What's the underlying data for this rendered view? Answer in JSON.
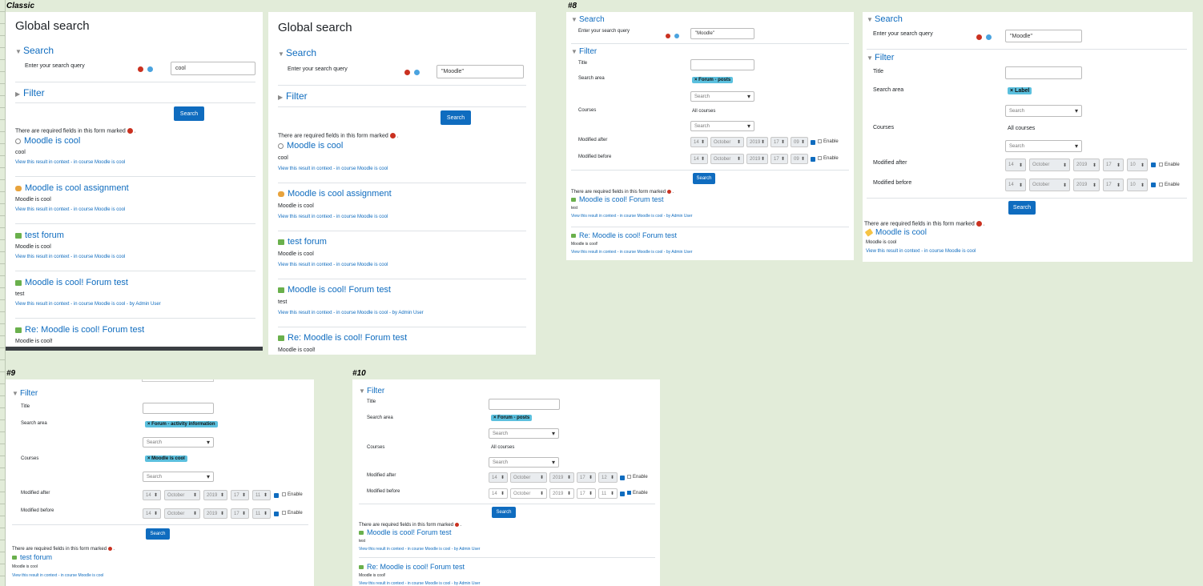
{
  "labels": {
    "classic": "Classic",
    "s8": "#8",
    "s9": "#9",
    "s10": "#10"
  },
  "common": {
    "global_search": "Global search",
    "search": "Search",
    "filter": "Filter",
    "query_label": "Enter your search query",
    "required_note": "There are required fields in this form marked",
    "search_button": "Search",
    "title_label": "Title",
    "search_area_label": "Search area",
    "courses_label": "Courses",
    "modified_after_label": "Modified after",
    "modified_before_label": "Modified before",
    "enable": "Enable",
    "select_placeholder": "Search",
    "all_courses": "All courses",
    "day": "14",
    "month": "October",
    "year": "2019",
    "hour": "17"
  },
  "query": {
    "cool": "cool",
    "moodle": "\"Moodle\""
  },
  "results": [
    {
      "icon": "cool-icon",
      "title": "Moodle is cool",
      "body": "cool",
      "link": "View this result in context",
      "course": "in course Moodle is cool",
      "author": ""
    },
    {
      "icon": "assignment-icon",
      "title": "Moodle is cool assignment",
      "body": "Moodle is cool",
      "link": "View this result in context",
      "course": "in course Moodle is cool",
      "author": ""
    },
    {
      "icon": "forum-icon",
      "title": "test forum",
      "body": "Moodle is cool",
      "link": "View this result in context",
      "course": "in course Moodle is cool",
      "author": ""
    },
    {
      "icon": "forum-icon",
      "title": "Moodle is cool! Forum test",
      "body": "test",
      "link": "View this result in context",
      "course": "in course Moodle is cool",
      "author": "by Admin User"
    },
    {
      "icon": "forum-icon",
      "title": "Re: Moodle is cool! Forum test",
      "body": "Moodle is cool!",
      "link": "View this result in context",
      "course": "in course Moodle is cool",
      "author": "by Admin User"
    }
  ],
  "p8a": {
    "area_tag": "Forum - posts",
    "min_after": "09",
    "min_before": "09"
  },
  "p8b": {
    "area_tag": "Label",
    "min_after": "10",
    "min_before": "10",
    "result_title": "Moodle is cool",
    "result_body": "Moodle is cool"
  },
  "p9": {
    "area_tag": "Forum - activity information",
    "course_tag": "Moodle is cool",
    "min_after": "11",
    "min_before": "11"
  },
  "p10": {
    "area_tag": "Forum - posts",
    "min_after": "12",
    "min_before": "11"
  },
  "colors": {
    "link": "#0f6cbf",
    "tag": "#5bc0de",
    "warning": "#ca3120",
    "background": "#e2ecd9"
  }
}
